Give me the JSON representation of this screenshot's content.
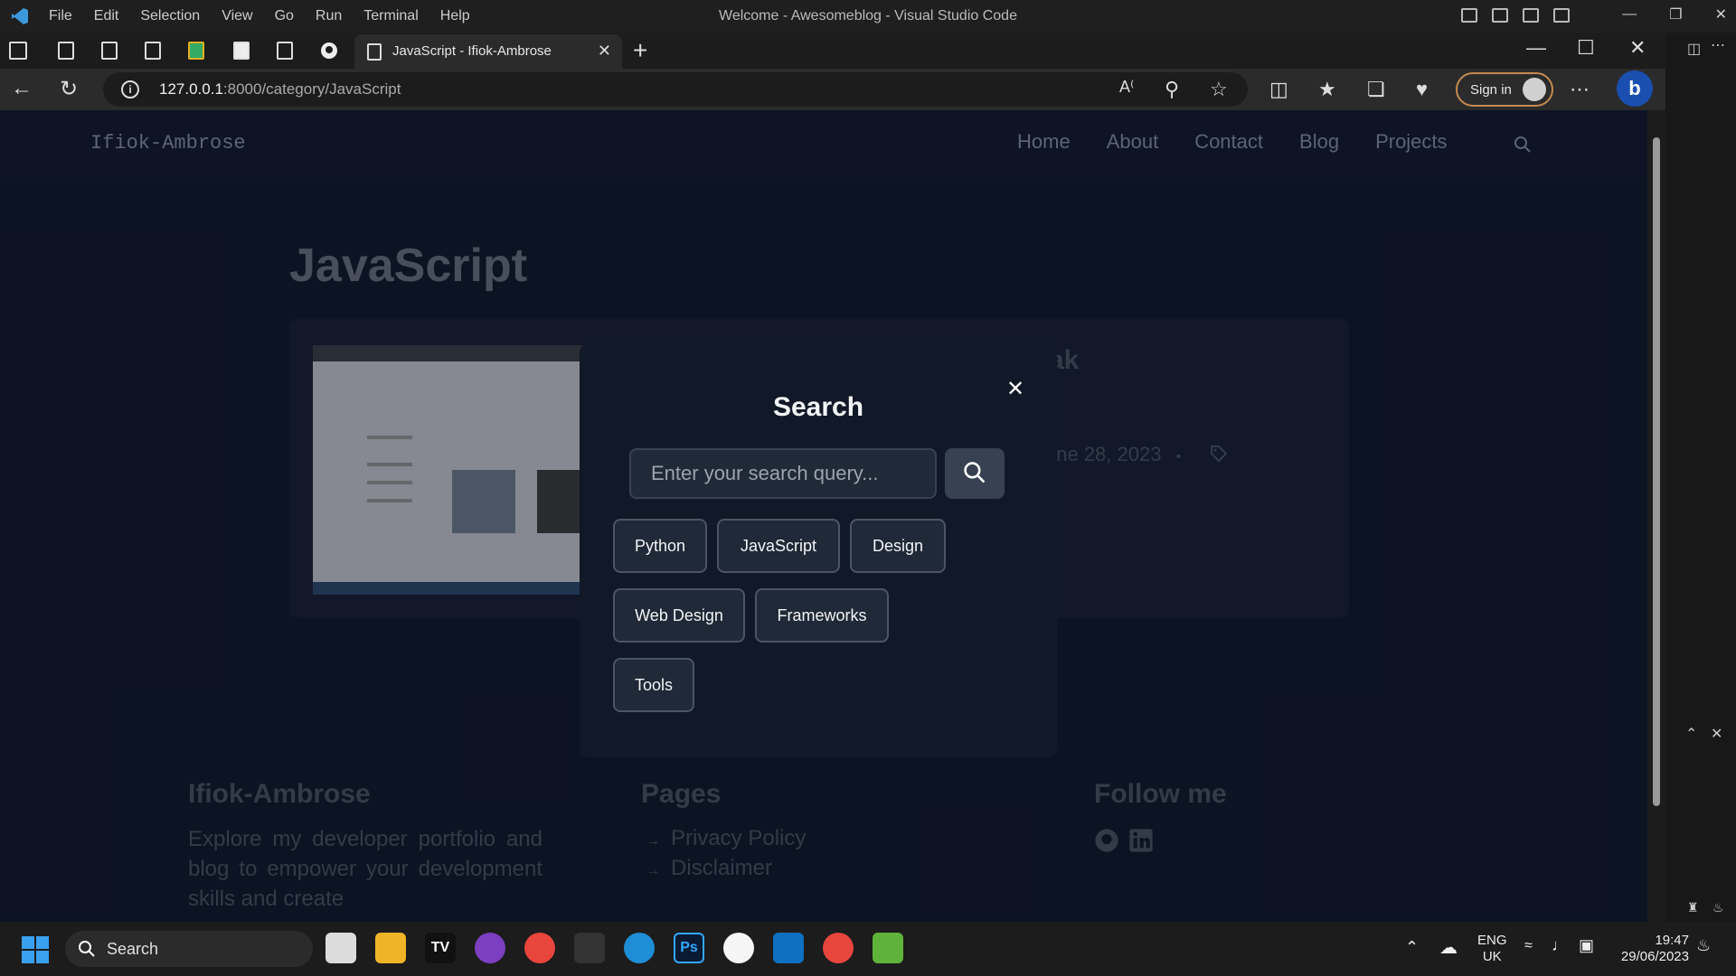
{
  "vscode": {
    "menu": [
      "File",
      "Edit",
      "Selection",
      "View",
      "Go",
      "Run",
      "Terminal",
      "Help"
    ],
    "title": "Welcome - Awesomeblog - Visual Studio Code"
  },
  "browser": {
    "tab_title": "JavaScript - Ifiok-Ambrose",
    "url_host": "127.0.0.1",
    "url_path": ":8000/category/JavaScript",
    "sign_in": "Sign in"
  },
  "site": {
    "logo": "Ifiok-Ambrose",
    "nav": [
      "Home",
      "About",
      "Contact",
      "Blog",
      "Projects"
    ],
    "category_title": "JavaScript",
    "post_title_fragment": "ak",
    "post_date_fragment": "une 28, 2023",
    "post_separator": "•"
  },
  "modal": {
    "title": "Search",
    "placeholder": "Enter your search query...",
    "tags": [
      "Python",
      "JavaScript",
      "Design",
      "Web Design",
      "Frameworks",
      "Tools"
    ]
  },
  "footer": {
    "brand_title": "Ifiok-Ambrose",
    "brand_text": "Explore my developer portfolio and blog to empower your development skills and create",
    "pages_title": "Pages",
    "pages": [
      "Privacy Policy",
      "Disclaimer"
    ],
    "follow_title": "Follow me"
  },
  "taskbar": {
    "search_label": "Search",
    "lang": "ENG",
    "region": "UK",
    "time": "19:47",
    "date": "29/06/2023"
  },
  "colors": {
    "accent_signin": "#c58a50",
    "page_bg": "#0f172a",
    "modal_bg": "#111827"
  }
}
